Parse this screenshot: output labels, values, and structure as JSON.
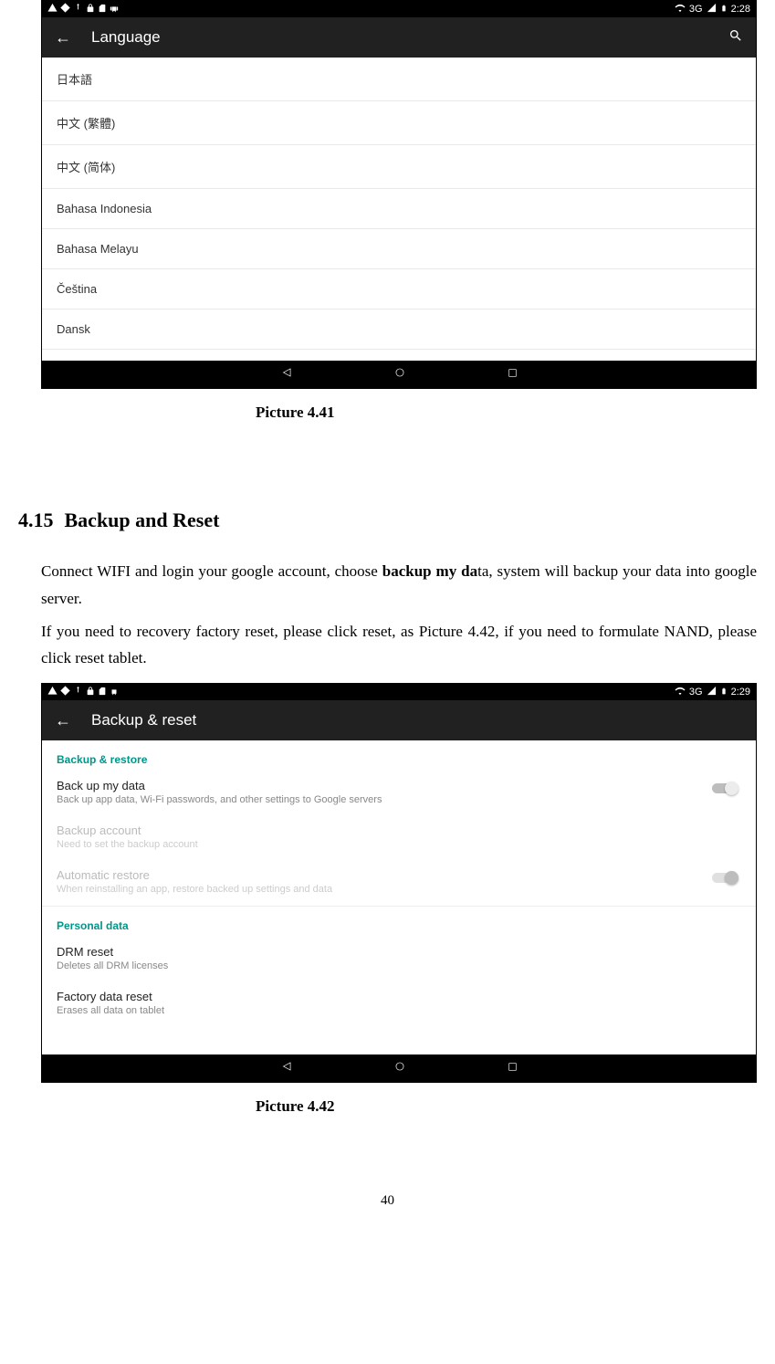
{
  "screenshot1": {
    "status": {
      "network_label": "3G",
      "time": "2:28"
    },
    "app_bar": {
      "title": "Language"
    },
    "languages": [
      "日本語",
      "中文 (繁體)",
      "中文 (简体)",
      "Bahasa Indonesia",
      "Bahasa Melayu",
      "Čeština",
      "Dansk"
    ]
  },
  "caption1": "Picture 4.41",
  "section": {
    "number": "4.15",
    "title": "Backup and Reset"
  },
  "para1_pre": "Connect WIFI and login your google account, choose ",
  "para1_bold": "backup my da",
  "para1_post": "ta, system will backup your data into google server.",
  "para2": "If you need to recovery factory reset, please click reset, as Picture 4.42, if you need to formulate NAND, please click reset tablet.",
  "screenshot2": {
    "status": {
      "network_label": "3G",
      "time": "2:29"
    },
    "app_bar": {
      "title": "Backup & reset"
    },
    "section1_header": "Backup & restore",
    "backup_data": {
      "title": "Back up my data",
      "subtitle": "Back up app data, Wi-Fi passwords, and other settings to Google servers"
    },
    "backup_account": {
      "title": "Backup account",
      "subtitle": "Need to set the backup account"
    },
    "auto_restore": {
      "title": "Automatic restore",
      "subtitle": "When reinstalling an app, restore backed up settings and data"
    },
    "section2_header": "Personal data",
    "drm_reset": {
      "title": "DRM reset",
      "subtitle": "Deletes all DRM licenses"
    },
    "factory_reset": {
      "title": "Factory data reset",
      "subtitle": "Erases all data on tablet"
    }
  },
  "caption2": "Picture 4.42",
  "page_number": "40"
}
